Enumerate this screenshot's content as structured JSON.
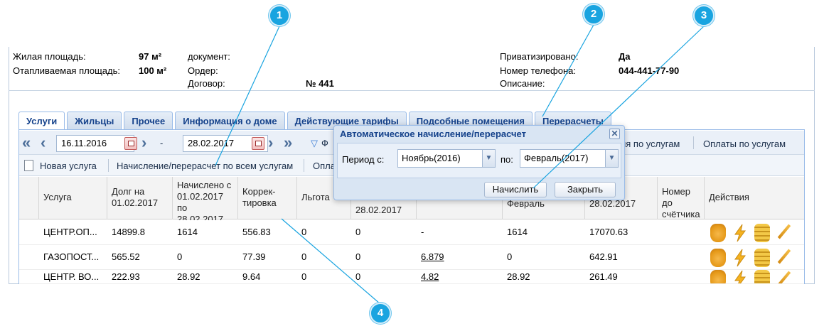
{
  "info": {
    "living_area_label": "Жилая площадь:",
    "living_area_value": "97 м²",
    "heated_area_label": "Отапливаемая площадь:",
    "heated_area_value": "100 м²",
    "document_label": "документ:",
    "order_label": "Ордер:",
    "contract_label": "Договор:",
    "contract_value": "№ 441",
    "privatized_label": "Приватизировано:",
    "privatized_value": "Да",
    "phone_label": "Номер телефона:",
    "phone_value": "044-441-77-90",
    "description_label": "Описание:"
  },
  "tabs": [
    {
      "label": "Услуги",
      "active": true
    },
    {
      "label": "Жильцы"
    },
    {
      "label": "Прочее"
    },
    {
      "label": "Информация о доме"
    },
    {
      "label": "Действующие тарифы"
    },
    {
      "label": "Подсобные помещения"
    },
    {
      "label": "Перерасчеты"
    }
  ],
  "toolbar": {
    "date_from": "16.11.2016",
    "date_dash": "-",
    "date_to": "28.02.2017",
    "filter_partial": "Ф",
    "payments_partial": "ия по услугам",
    "payments_by_services": "Оплаты по услугам",
    "new_service": "Новая услуга",
    "recalc_all": "Начисление/перерасчет по всем услугам",
    "pay_partial": "Опла"
  },
  "grid": {
    "headers": {
      "service": "Услуга",
      "debt": "Долг на 01.02.2017",
      "charged": "Начислено с 01.02.2017 по 28.02.2017",
      "correction": "Коррек-тировка",
      "benefit": "Льгота",
      "col6": "28.02.2017",
      "col8": "Февраль",
      "col9": "28.02.2017",
      "meter": "Номер до счётчика",
      "actions": "Действия"
    },
    "rows": [
      {
        "service": "ЦЕНТР.ОП...",
        "debt": "14899.8",
        "charged": "1614",
        "correction": "556.83",
        "benefit": "0",
        "c6": "0",
        "c7": "-",
        "c8": "1614",
        "c9": "17070.63"
      },
      {
        "service": "ГАЗОПОСТ...",
        "debt": "565.52",
        "charged": "0",
        "correction": "77.39",
        "benefit": "0",
        "c6": "0",
        "c7": "6.879",
        "c8": "0",
        "c9": "642.91"
      },
      {
        "service": "ЦЕНТР. ВО...",
        "debt": "222.93",
        "charged": "28.92",
        "correction": "9.64",
        "benefit": "0",
        "c6": "0",
        "c7": "4.82",
        "c8": "28.92",
        "c9": "261.49"
      }
    ]
  },
  "modal": {
    "title": "Автоматическое начисление/перерасчет",
    "period_from_label": "Период с:",
    "period_from_value": "Ноябрь(2016)",
    "period_to_label": "по:",
    "period_to_value": "Февраль(2017)",
    "calc_button": "Начислить",
    "close_button": "Закрыть"
  },
  "callouts": [
    "1",
    "2",
    "3",
    "4"
  ],
  "colors": {
    "accent": "#15428b",
    "callout": "#19a4e0"
  }
}
